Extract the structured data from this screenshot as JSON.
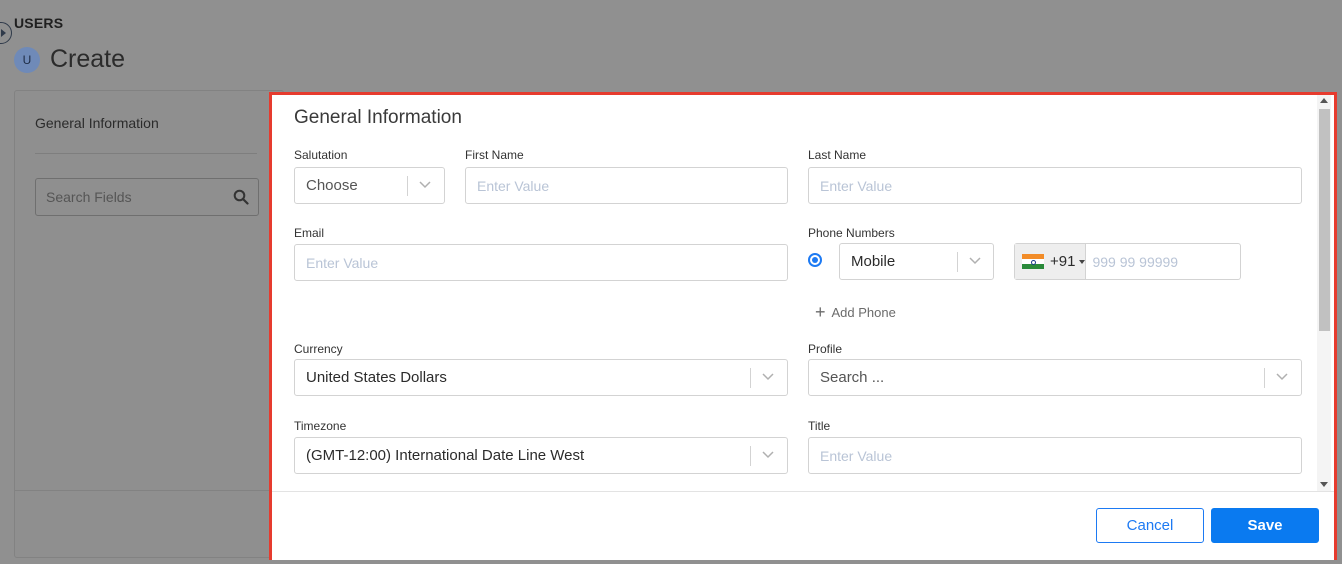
{
  "app": {
    "module_label": "USERS",
    "avatar_initial": "U",
    "page_title": "Create"
  },
  "sidebar": {
    "section_title": "General Information",
    "search_placeholder": "Search Fields"
  },
  "modal": {
    "section_title": "General Information",
    "fields": {
      "salutation": {
        "label": "Salutation",
        "value": "Choose"
      },
      "first_name": {
        "label": "First Name",
        "placeholder": "Enter Value"
      },
      "last_name": {
        "label": "Last Name",
        "placeholder": "Enter Value"
      },
      "email": {
        "label": "Email",
        "placeholder": "Enter Value"
      },
      "phone_numbers": {
        "label": "Phone Numbers",
        "type_value": "Mobile",
        "country_code": "+91",
        "placeholder": "999 99 99999"
      },
      "add_phone": "Add Phone",
      "currency": {
        "label": "Currency",
        "value": "United States Dollars"
      },
      "profile": {
        "label": "Profile",
        "placeholder": "Search ..."
      },
      "timezone": {
        "label": "Timezone",
        "value": "(GMT-12:00) International Date Line West"
      },
      "title": {
        "label": "Title",
        "placeholder": "Enter Value"
      }
    },
    "buttons": {
      "cancel": "Cancel",
      "save": "Save"
    }
  },
  "colors": {
    "accent": "#0a7af0",
    "modal_outline": "#e63b2e",
    "overlay": "#8f8f8f"
  }
}
